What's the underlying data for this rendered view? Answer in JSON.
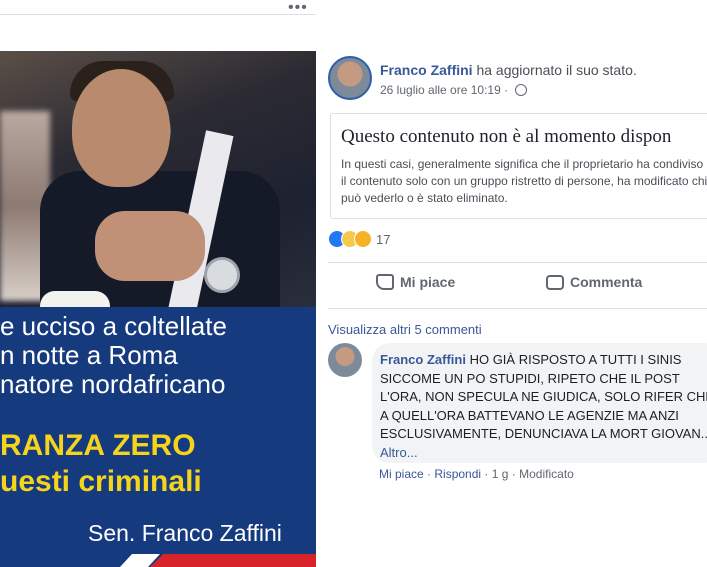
{
  "left": {
    "more_label": "•••",
    "banner": {
      "line1": "e ucciso a coltellate",
      "line2": "n notte a Roma",
      "line3": "natore nordafricano",
      "yellow1": "RANZA ZERO",
      "yellow2": "uesti criminali",
      "signature": "Sen. Franco Zaffini"
    }
  },
  "post": {
    "author": "Franco Zaffini",
    "action_text": "ha aggiornato il suo stato.",
    "date": "26 luglio alle ore 10:19 ·",
    "privacy_icon": "globe-icon",
    "unavailable": {
      "title": "Questo contenuto non è al momento dispon",
      "description": "In questi casi, generalmente significa che il proprietario ha condiviso il contenuto solo con un gruppo ristretto di persone, ha modificato chi può vederlo o è stato eliminato."
    },
    "reactions": {
      "icons": [
        "like-icon",
        "sad-icon",
        "haha-icon"
      ],
      "count": "17"
    },
    "actions": {
      "like": "Mi piace",
      "comment": "Commenta"
    }
  },
  "comments": {
    "view_more": "Visualizza altri 5 commenti",
    "items": [
      {
        "author": "Franco Zaffini",
        "text": "HO GIÀ RISPOSTO A TUTTI I SINIS SICCOME UN PO STUPIDI, RIPETO CHE IL POST L'ORA, NON SPECULA NE GIUDICA, SOLO RIFER CHE A QUELL'ORA BATTEVANO LE AGENZIE MA ANZI ESCLUSIVAMENTE, DENUNCIAVA LA MORT GIOVAN...",
        "see_more": "Altro...",
        "like": "Mi piace",
        "reply": "Rispondi",
        "time": "1 g",
        "edited": "Modificato"
      }
    ]
  },
  "colors": {
    "link_blue": "#385898",
    "banner_blue": "#163a7e",
    "banner_yellow": "#f6d41b",
    "accent_red": "#d8232a"
  }
}
